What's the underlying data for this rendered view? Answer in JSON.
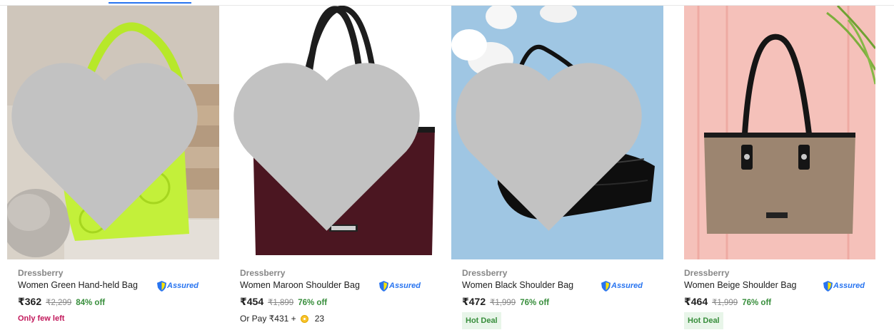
{
  "colors": {
    "accent": "#2874f0",
    "discount": "#388e3c",
    "urgency": "#c2185b",
    "muted": "#878787",
    "hot_deal_bg": "#e8f5e9"
  },
  "products": [
    {
      "brand": "Dressberry",
      "title": "Women Green Hand-held Bag",
      "assured": "Assured",
      "price": "₹362",
      "mrp": "₹2,299",
      "discount": "84% off",
      "extra": "Only few left",
      "image_icon": "green-quilted-handbag-image"
    },
    {
      "brand": "Dressberry",
      "title": "Women Maroon Shoulder Bag",
      "assured": "Assured",
      "price": "₹454",
      "mrp": "₹1,899",
      "discount": "76% off",
      "extra_prefix": "Or Pay ₹431 +",
      "extra_coins": "23",
      "image_icon": "maroon-tote-bag-image"
    },
    {
      "brand": "Dressberry",
      "title": "Women Black Shoulder Bag",
      "assured": "Assured",
      "price": "₹472",
      "mrp": "₹1,999",
      "discount": "76% off",
      "extra": "Hot Deal",
      "image_icon": "black-shoulder-bag-image"
    },
    {
      "brand": "Dressberry",
      "title": "Women Beige Shoulder Bag",
      "assured": "Assured",
      "price": "₹464",
      "mrp": "₹1,999",
      "discount": "76% off",
      "extra": "Hot Deal",
      "image_icon": "beige-tote-bag-image"
    }
  ]
}
